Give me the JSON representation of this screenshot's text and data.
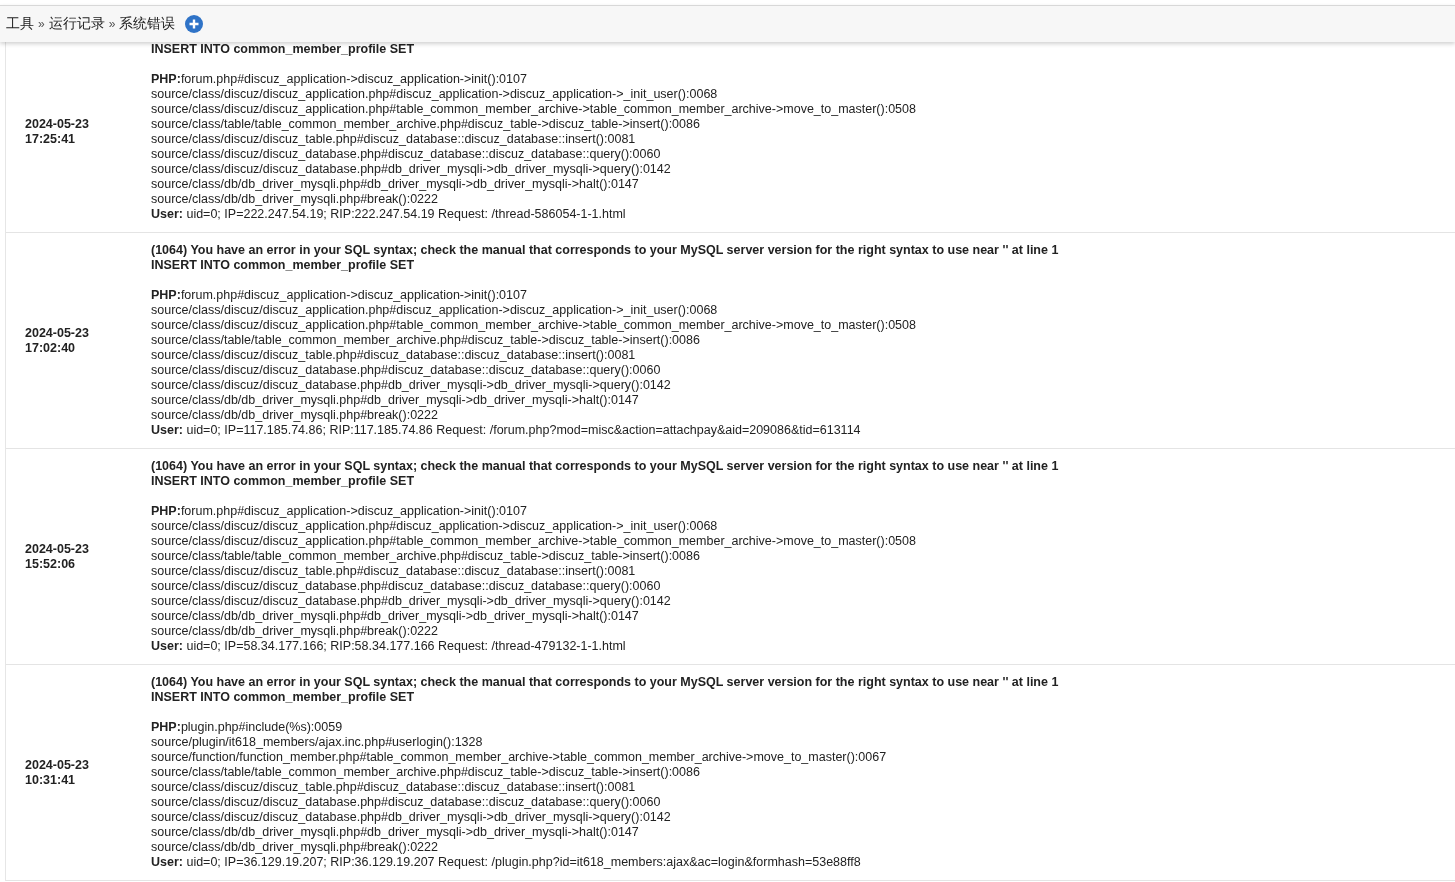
{
  "breadcrumb": {
    "items": [
      "工具",
      "运行记录",
      "系统错误"
    ],
    "separator": "»"
  },
  "entries": [
    {
      "date": "2024-05-23",
      "time": "17:25:41",
      "sql": "INSERT INTO common_member_profile SET",
      "php": "**PHP:**forum.php#discuz_application->discuz_application->init():0107",
      "trace": [
        "source/class/discuz/discuz_application.php#discuz_application->discuz_application->_init_user():0068",
        "source/class/discuz/discuz_application.php#table_common_member_archive->table_common_member_archive->move_to_master():0508",
        "source/class/table/table_common_member_archive.php#discuz_table->discuz_table->insert():0086",
        "source/class/discuz/discuz_table.php#discuz_database::discuz_database::insert():0081",
        "source/class/discuz/discuz_database.php#discuz_database::discuz_database::query():0060",
        "source/class/discuz/discuz_database.php#db_driver_mysqli->db_driver_mysqli->query():0142",
        "source/class/db/db_driver_mysqli.php#db_driver_mysqli->db_driver_mysqli->halt():0147",
        "source/class/db/db_driver_mysqli.php#break():0222"
      ],
      "user": "**User:** uid=0; IP=222.247.54.19; RIP:222.247.54.19 Request: /thread-586054-1-1.html"
    },
    {
      "date": "2024-05-23",
      "time": "17:02:40",
      "error": "(1064) You have an error in your SQL syntax; check the manual that corresponds to your MySQL server version for the right syntax to use near '' at line 1",
      "sql": "INSERT INTO common_member_profile SET",
      "php": "**PHP:**forum.php#discuz_application->discuz_application->init():0107",
      "trace": [
        "source/class/discuz/discuz_application.php#discuz_application->discuz_application->_init_user():0068",
        "source/class/discuz/discuz_application.php#table_common_member_archive->table_common_member_archive->move_to_master():0508",
        "source/class/table/table_common_member_archive.php#discuz_table->discuz_table->insert():0086",
        "source/class/discuz/discuz_table.php#discuz_database::discuz_database::insert():0081",
        "source/class/discuz/discuz_database.php#discuz_database::discuz_database::query():0060",
        "source/class/discuz/discuz_database.php#db_driver_mysqli->db_driver_mysqli->query():0142",
        "source/class/db/db_driver_mysqli.php#db_driver_mysqli->db_driver_mysqli->halt():0147",
        "source/class/db/db_driver_mysqli.php#break():0222"
      ],
      "user": "**User:** uid=0; IP=117.185.74.86; RIP:117.185.74.86 Request: /forum.php?mod=misc&action=attachpay&aid=209086&tid=613114"
    },
    {
      "date": "2024-05-23",
      "time": "15:52:06",
      "error": "(1064) You have an error in your SQL syntax; check the manual that corresponds to your MySQL server version for the right syntax to use near '' at line 1",
      "sql": "INSERT INTO common_member_profile SET",
      "php": "**PHP:**forum.php#discuz_application->discuz_application->init():0107",
      "trace": [
        "source/class/discuz/discuz_application.php#discuz_application->discuz_application->_init_user():0068",
        "source/class/discuz/discuz_application.php#table_common_member_archive->table_common_member_archive->move_to_master():0508",
        "source/class/table/table_common_member_archive.php#discuz_table->discuz_table->insert():0086",
        "source/class/discuz/discuz_table.php#discuz_database::discuz_database::insert():0081",
        "source/class/discuz/discuz_database.php#discuz_database::discuz_database::query():0060",
        "source/class/discuz/discuz_database.php#db_driver_mysqli->db_driver_mysqli->query():0142",
        "source/class/db/db_driver_mysqli.php#db_driver_mysqli->db_driver_mysqli->halt():0147",
        "source/class/db/db_driver_mysqli.php#break():0222"
      ],
      "user": "**User:** uid=0; IP=58.34.177.166; RIP:58.34.177.166 Request: /thread-479132-1-1.html"
    },
    {
      "date": "2024-05-23",
      "time": "10:31:41",
      "error": "(1064) You have an error in your SQL syntax; check the manual that corresponds to your MySQL server version for the right syntax to use near '' at line 1",
      "sql": "INSERT INTO common_member_profile SET",
      "php": "**PHP:**plugin.php#include(%s):0059",
      "trace": [
        "source/plugin/it618_members/ajax.inc.php#userlogin():1328",
        "source/function/function_member.php#table_common_member_archive->table_common_member_archive->move_to_master():0067",
        "source/class/table/table_common_member_archive.php#discuz_table->discuz_table->insert():0086",
        "source/class/discuz/discuz_table.php#discuz_database::discuz_database::insert():0081",
        "source/class/discuz/discuz_database.php#discuz_database::discuz_database::query():0060",
        "source/class/discuz/discuz_database.php#db_driver_mysqli->db_driver_mysqli->query():0142",
        "source/class/db/db_driver_mysqli.php#db_driver_mysqli->db_driver_mysqli->halt():0147",
        "source/class/db/db_driver_mysqli.php#break():0222"
      ],
      "user": "**User:** uid=0; IP=36.129.19.207; RIP:36.129.19.207 Request: /plugin.php?id=it618_members:ajax&ac=login&formhash=53e88ff8"
    }
  ]
}
